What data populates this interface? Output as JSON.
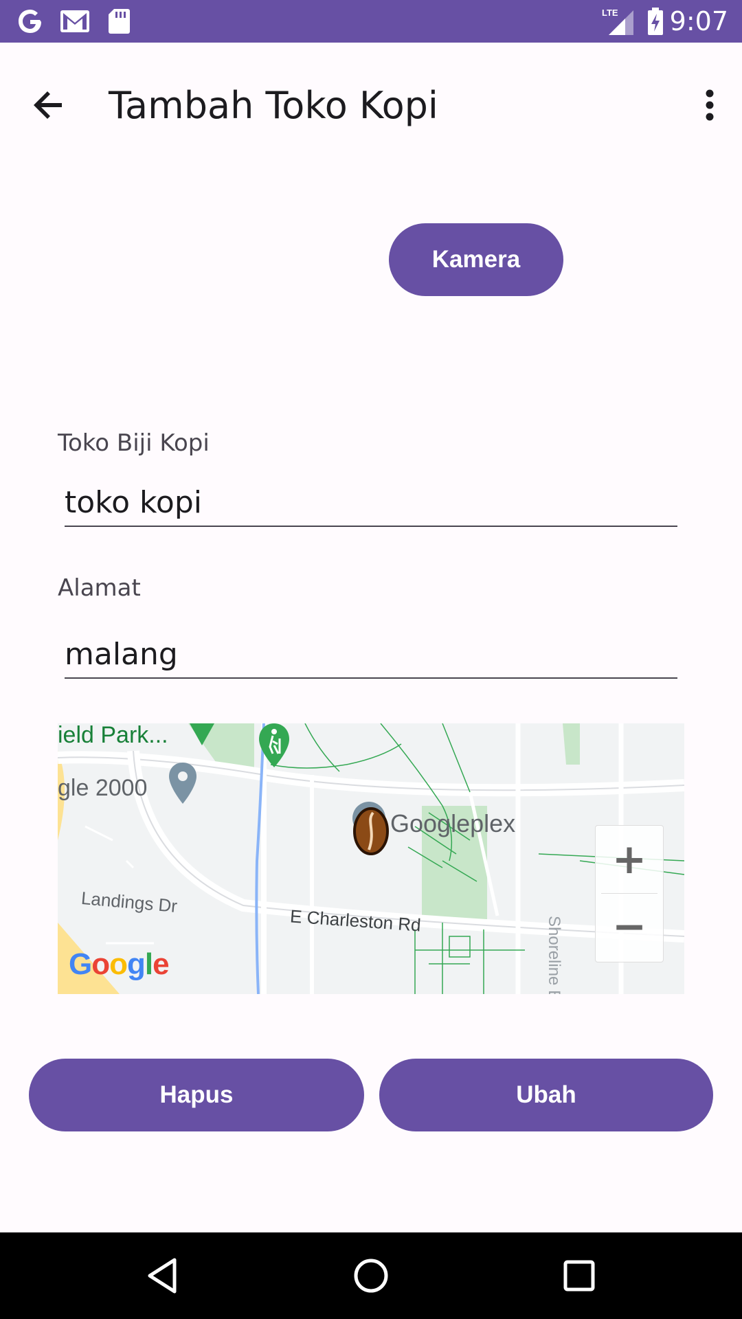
{
  "status_bar": {
    "time": "9:07",
    "network": "LTE",
    "icons": [
      "google-icon",
      "gmail-icon",
      "sd-card-icon",
      "signal-icon",
      "battery-charging-icon"
    ],
    "background": "#6750a4"
  },
  "app_bar": {
    "title": "Tambah Toko Kopi",
    "back_icon": "arrow-back-icon",
    "menu_icon": "more-vert-icon"
  },
  "buttons": {
    "camera": "Kamera",
    "delete": "Hapus",
    "update": "Ubah",
    "color": "#6750a4"
  },
  "form": {
    "name": {
      "label": "Toko Biji Kopi",
      "value": "toko kopi"
    },
    "address": {
      "label": "Alamat",
      "value": "malang"
    }
  },
  "map": {
    "labels": {
      "park": "ield Park...",
      "place_2000": "gle 2000",
      "googleplex": "Googleplex",
      "landings": "Landings Dr",
      "charleston": "E Charleston Rd",
      "shoreline": "Shoreline Blvd"
    },
    "logo": "Google",
    "marker": "coffee-bean-marker",
    "zoom_in": "+",
    "zoom_out": "−"
  },
  "nav_bar": {
    "back": "nav-back-icon",
    "home": "nav-home-icon",
    "recents": "nav-recents-icon"
  }
}
